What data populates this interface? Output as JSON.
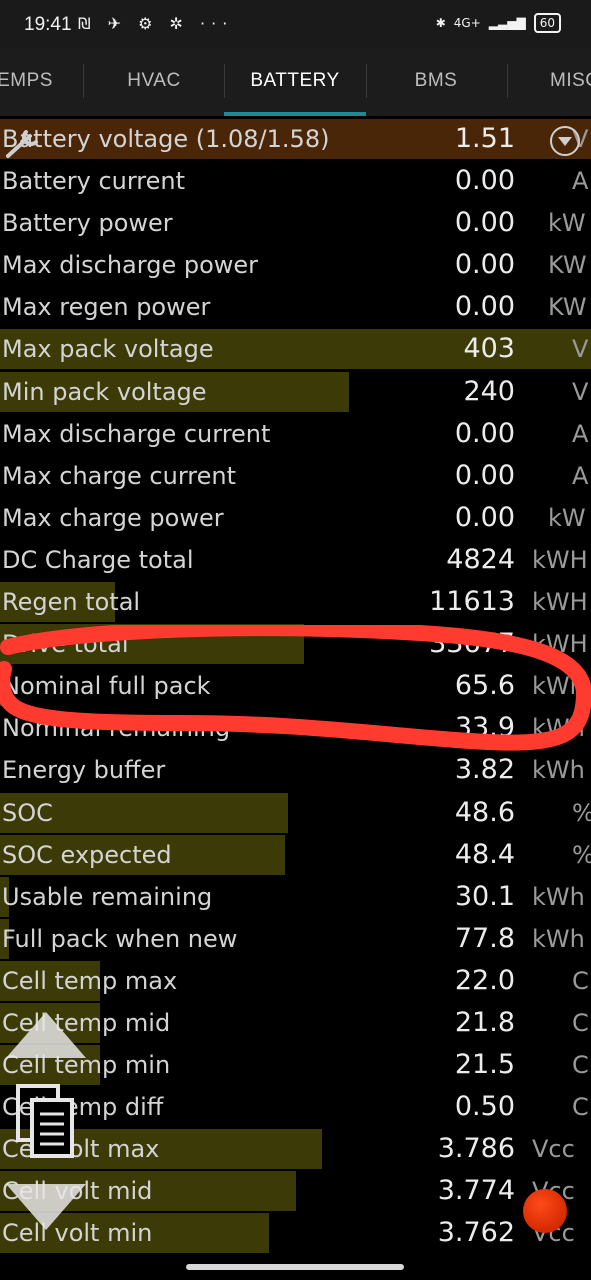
{
  "status_bar": {
    "time": "19:41",
    "left_icons": "₪ ✈ ⚙ ✲ ···",
    "network": "4G+",
    "battery": "60"
  },
  "tabs": [
    {
      "label": "EMPS",
      "active": false
    },
    {
      "label": "HVAC",
      "active": false
    },
    {
      "label": "BATTERY",
      "active": true
    },
    {
      "label": "BMS",
      "active": false
    },
    {
      "label": "MISC",
      "active": false
    }
  ],
  "rows": [
    {
      "label": "Battery voltage (1.08/1.58)",
      "value": "1.51",
      "unit": "V",
      "fill": 1.0,
      "highlight": true
    },
    {
      "label": "Battery current",
      "value": "0.00",
      "unit": "A",
      "fill": 0
    },
    {
      "label": "Battery power",
      "value": "0.00",
      "unit": "kW",
      "fill": 0
    },
    {
      "label": "Max discharge power",
      "value": "0.00",
      "unit": "KW",
      "fill": 0
    },
    {
      "label": "Max regen power",
      "value": "0.00",
      "unit": "KW",
      "fill": 0
    },
    {
      "label": "Max pack voltage",
      "value": "403",
      "unit": "V",
      "fill": 1.0
    },
    {
      "label": "Min pack voltage",
      "value": "240",
      "unit": "V",
      "fill": 0.59
    },
    {
      "label": "Max discharge current",
      "value": "0.00",
      "unit": "A",
      "fill": 0
    },
    {
      "label": "Max charge current",
      "value": "0.00",
      "unit": "A",
      "fill": 0
    },
    {
      "label": "Max charge power",
      "value": "0.00",
      "unit": "kW",
      "fill": 0
    },
    {
      "label": "DC Charge total",
      "value": "4824",
      "unit": "kWH",
      "fill": 0
    },
    {
      "label": "Regen total",
      "value": "11613",
      "unit": "kWH",
      "fill": 0.195
    },
    {
      "label": "Drive total",
      "value": "33677",
      "unit": "kWH",
      "fill": 0.515
    },
    {
      "label": "Nominal full pack",
      "value": "65.6",
      "unit": "kWh",
      "fill": 0.012
    },
    {
      "label": "Nominal remaining",
      "value": "33.9",
      "unit": "kWh",
      "fill": 0
    },
    {
      "label": "Energy buffer",
      "value": "3.82",
      "unit": "kWh",
      "fill": 0
    },
    {
      "label": "SOC",
      "value": "48.6",
      "unit": "%",
      "fill": 0.487
    },
    {
      "label": "SOC expected",
      "value": "48.4",
      "unit": "%",
      "fill": 0.483
    },
    {
      "label": "Usable remaining",
      "value": "30.1",
      "unit": "kWh",
      "fill": 0.015
    },
    {
      "label": "Full pack when new",
      "value": "77.8",
      "unit": "kWh",
      "fill": 0.015
    },
    {
      "label": "Cell temp max",
      "value": "22.0",
      "unit": "C",
      "fill": 0.17
    },
    {
      "label": "Cell temp mid",
      "value": "21.8",
      "unit": "C",
      "fill": 0.17
    },
    {
      "label": "Cell temp min",
      "value": "21.5",
      "unit": "C",
      "fill": 0.17
    },
    {
      "label": "Cell temp diff",
      "value": "0.50",
      "unit": "C",
      "fill": 0
    },
    {
      "label": "Cell volt max",
      "value": "3.786",
      "unit": "Vcc",
      "fill": 0.545
    },
    {
      "label": "Cell volt mid",
      "value": "3.774",
      "unit": "Vcc",
      "fill": 0.5
    },
    {
      "label": "Cell volt min",
      "value": "3.762",
      "unit": "Vcc",
      "fill": 0.455
    }
  ],
  "colors": {
    "bar_fill": "#3c3a06",
    "highlight_fill": "#4a2608",
    "tab_indicator": "#1a8c8c",
    "annotation": "#ff3b30",
    "record_button": "#e03a0a"
  }
}
